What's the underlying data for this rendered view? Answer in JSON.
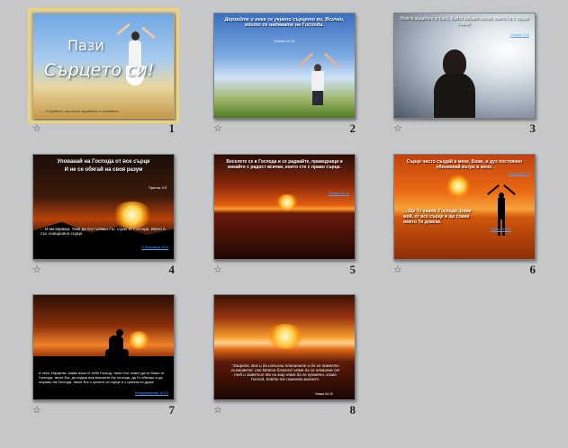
{
  "slides": [
    {
      "number": "1",
      "selected": true,
      "title_line1": "Пази",
      "title_line2": "Сърцето си!",
      "footer": "— Събудете, мислите наредете  и поведете"
    },
    {
      "number": "2",
      "title": "Дерзайте и нека се укрепи сърцето ви, Всички, които се надявате на Господа.",
      "ref": "Псалм 31:24"
    },
    {
      "number": "3",
      "title": "Моята защита е в Бога, Който избавя онези, които са с право сърце.",
      "ref": "Псалм 7:10"
    },
    {
      "number": "4",
      "title_line1": "Уповавай на Господа от все сърце",
      "title_line2": "И не се обягай на своя разум",
      "ref_top": "Притчи 3:5",
      "body": "... И им вярваш: Това да постъпваш със страх от Господа, вярно и със съвършено сърце.",
      "ref": "2 Летописи 19:9"
    },
    {
      "number": "5",
      "title": "Веселете се в Господа и се радвайте, праведници и викайте с радост всички, които сте с право сърце.",
      "ref": "Псалм 32:11"
    },
    {
      "number": "6",
      "title": "Сърце чисто създай в мене, Боже, и дух постоянен обновявай вътре в мене.",
      "ref_top": "Псалм 51:10",
      "body": "... Ще Те хваля, Господи, Боже мой, от все сърце и ще славя името Ти довека.",
      "ref": "Псалм 86:12"
    },
    {
      "number": "7",
      "body": "А сега, Израилю, какво иска от тебе Господ, твоят Бог освен да се боиш от Господа, твоят Бог, да ходиш във всичките Му пътища, да Го обичаш и да служиш на Господа, твоят Бог с цялото си сърце и с цялата си душа.",
      "ref": "Второзаконие 10:12"
    },
    {
      "number": "8",
      "body": "\"Защото, Бог и да изпълни планините и да се помести хълмовете, пак Моята благост няма да се отмахне от теб и заветът Ми на мир няма да се промени, казва Господ, Който те помилва милост.",
      "ref": "Исаия 54:10"
    }
  ],
  "icons": {
    "transition_icon": "star-outline-icon"
  },
  "colors": {
    "background": "#c6c7c8",
    "selection": "#f4d36a"
  }
}
